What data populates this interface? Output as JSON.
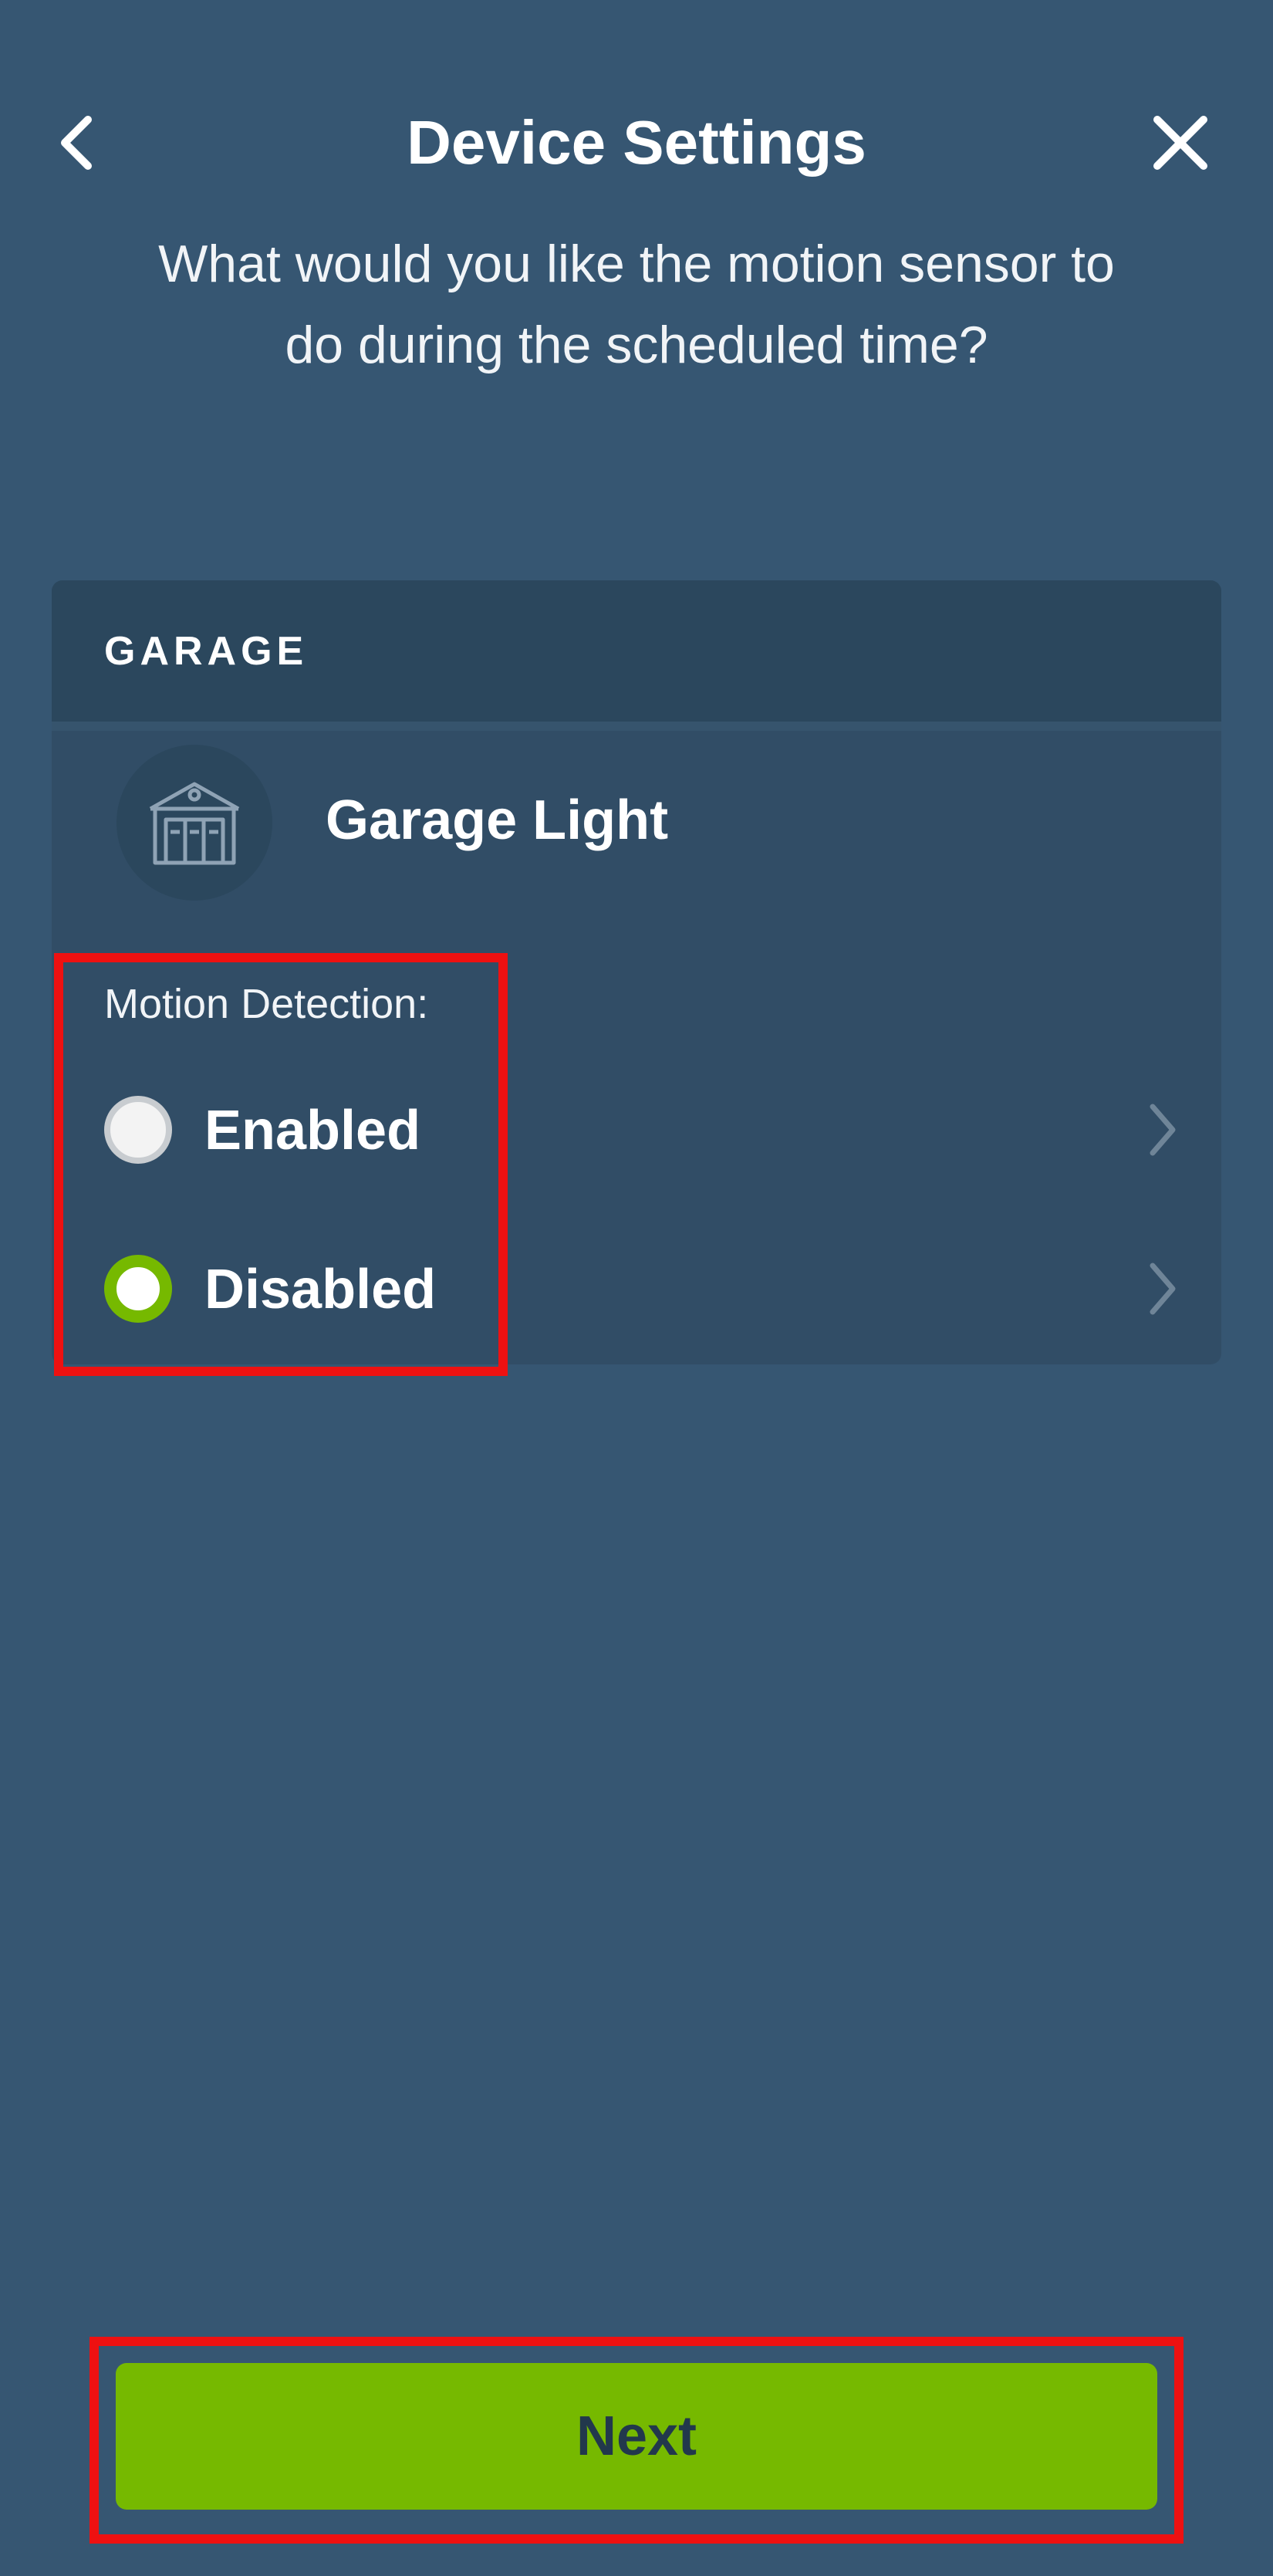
{
  "header": {
    "title": "Device Settings",
    "back_icon": "chevron-left-icon",
    "close_icon": "close-icon"
  },
  "subtitle": "What would you like the motion sensor to do during the scheduled time?",
  "card": {
    "section_label": "GARAGE",
    "device": {
      "name": "Garage Light",
      "icon": "garage-icon"
    },
    "motion_detection": {
      "label": "Motion Detection:",
      "options": [
        {
          "label": "Enabled",
          "selected": false
        },
        {
          "label": "Disabled",
          "selected": true
        }
      ]
    }
  },
  "footer": {
    "next_label": "Next"
  },
  "colors": {
    "background": "#365672",
    "card": "#314d66",
    "card_header": "#2b475d",
    "accent": "#76b900",
    "highlight": "#ee1111",
    "button_text": "#22384c"
  }
}
